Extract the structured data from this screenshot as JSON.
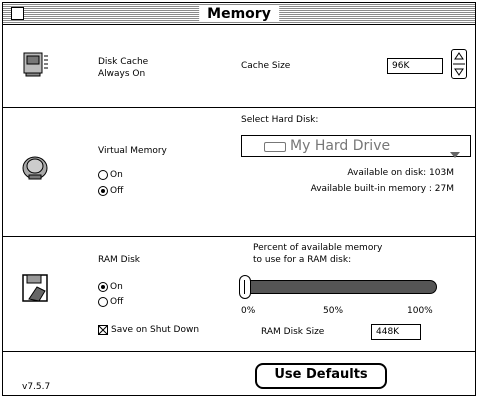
{
  "window": {
    "title": "Memory"
  },
  "disk_cache": {
    "label_line1": "Disk Cache",
    "label_line2": "Always On",
    "size_label": "Cache Size",
    "size_value": "96K"
  },
  "virtual_memory": {
    "label": "Virtual Memory",
    "on_label": "On",
    "off_label": "Off",
    "selected": "off",
    "select_disk_label": "Select Hard Disk:",
    "disk_name": "My Hard Drive",
    "available_on_disk": "Available on disk: 103M",
    "available_builtin": "Available built-in memory : 27M"
  },
  "ram_disk": {
    "label": "RAM Disk",
    "on_label": "On",
    "off_label": "Off",
    "selected": "on",
    "percent_line1": "Percent of available memory",
    "percent_line2": "to use for a RAM disk:",
    "slider_min": "0%",
    "slider_mid": "50%",
    "slider_max": "100%",
    "slider_value_percent": 0,
    "save_label": "Save on Shut Down",
    "save_checked": true,
    "size_label": "RAM Disk Size",
    "size_value": "448K"
  },
  "footer": {
    "version": "v7.5.7",
    "defaults_button": "Use Defaults"
  }
}
